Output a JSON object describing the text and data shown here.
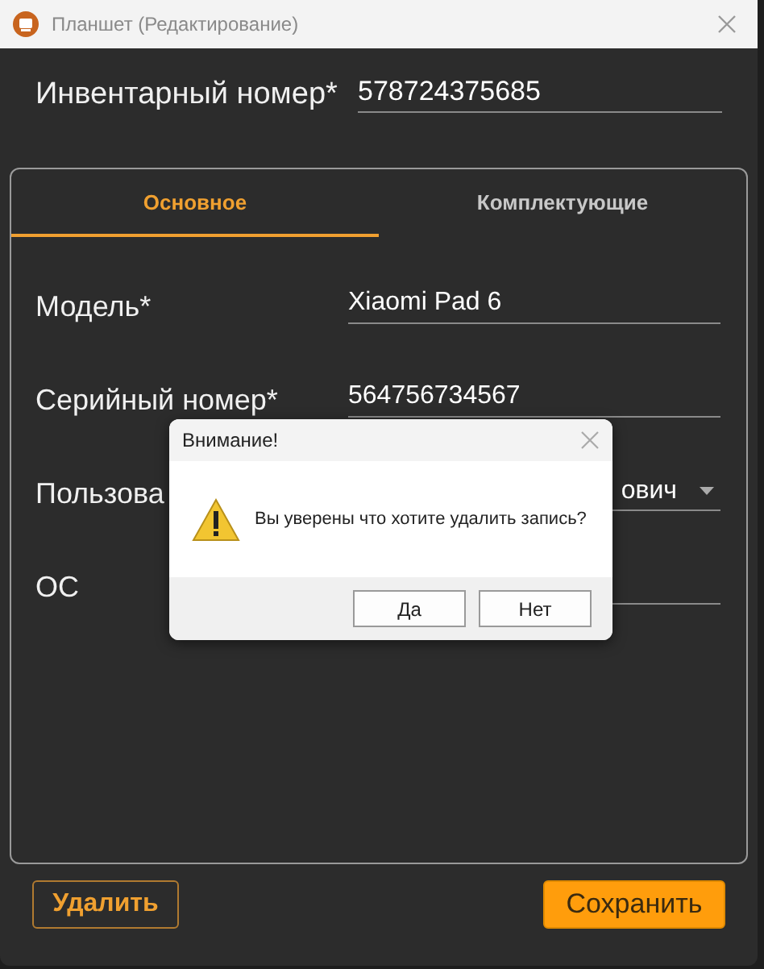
{
  "window": {
    "title": "Планшет (Редактирование)"
  },
  "inventory": {
    "label": "Инвентарный номер*",
    "value": "578724375685"
  },
  "tabs": [
    {
      "label": "Основное",
      "selected": true
    },
    {
      "label": "Комплектующие",
      "selected": false
    }
  ],
  "fields": [
    {
      "kind": "text",
      "label": "Модель*",
      "value": "Xiaomi Pad 6"
    },
    {
      "kind": "text",
      "label": "Серийный номер*",
      "value": "564756734567"
    },
    {
      "kind": "dropdown",
      "label": "Пользова",
      "value": "ович"
    },
    {
      "kind": "text",
      "label": "ОС"
    }
  ],
  "buttons": [
    {
      "kind": "outline",
      "label": "Удалить"
    },
    {
      "kind": "primary",
      "label": "Сохранить"
    }
  ],
  "dialog": {
    "title": "Внимание!",
    "message": "Вы уверены что хотите удалить запись?",
    "buttons": [
      {
        "label": "Да"
      },
      {
        "label": "Нет"
      }
    ]
  }
}
